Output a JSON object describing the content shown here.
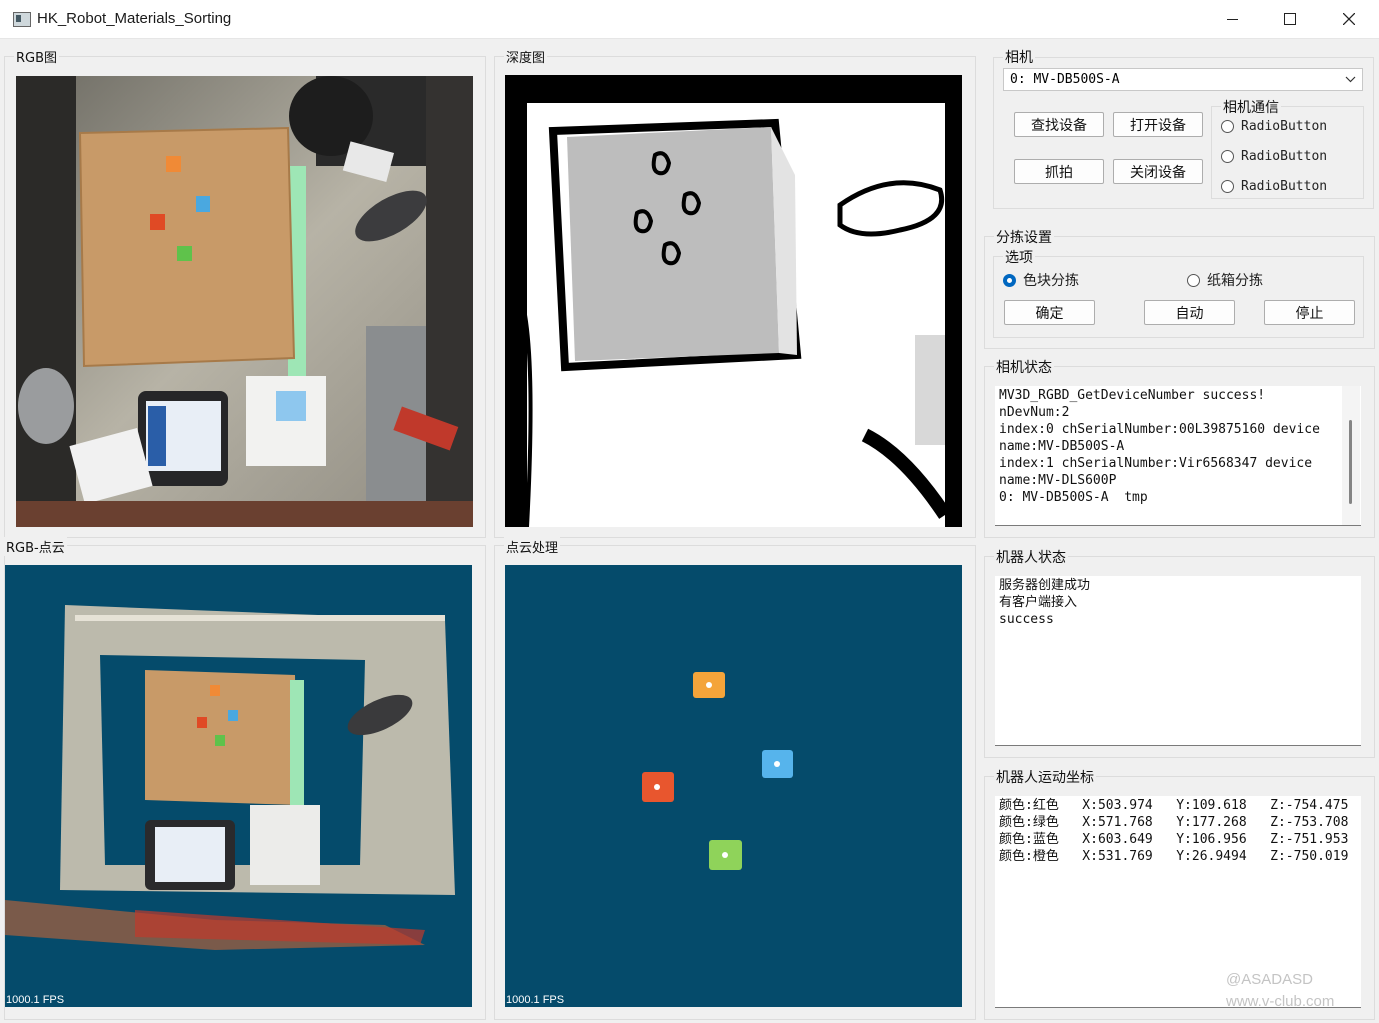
{
  "window": {
    "title": "HK_Robot_Materials_Sorting"
  },
  "panels": {
    "rgb": {
      "title": "RGB图"
    },
    "depth": {
      "title": "深度图"
    },
    "rgb_cloud": {
      "title": "RGB-点云",
      "fps": "1000.1 FPS"
    },
    "cloud_proc": {
      "title": "点云处理",
      "fps": "1000.1 FPS"
    }
  },
  "camera": {
    "title": "相机",
    "device_selected": "0: MV-DB500S-A",
    "buttons": {
      "find": "查找设备",
      "open": "打开设备",
      "capture": "抓拍",
      "close": "关闭设备"
    },
    "comm": {
      "title": "相机通信",
      "options": [
        "RadioButton",
        "RadioButton",
        "RadioButton"
      ]
    }
  },
  "sorting": {
    "title": "分拣设置",
    "options_title": "选项",
    "radio_color": "色块分拣",
    "radio_box": "纸箱分拣",
    "buttons": {
      "confirm": "确定",
      "auto": "自动",
      "stop": "停止"
    }
  },
  "camera_status": {
    "title": "相机状态",
    "text": "MV3D_RGBD_GetDeviceNumber success!\nnDevNum:2\nindex:0 chSerialNumber:00L39875160 device name:MV-DB500S-A\nindex:1 chSerialNumber:Vir6568347 device name:MV-DLS600P\n0: MV-DB500S-A  tmp"
  },
  "robot_status": {
    "title": "机器人状态",
    "text": "服务器创建成功\n有客户端接入\nsuccess"
  },
  "robot_coords": {
    "title": "机器人运动坐标",
    "text": "颜色:红色   X:503.974   Y:109.618   Z:-754.475\n颜色:绿色   X:571.768   Y:177.268   Z:-753.708\n颜色:蓝色   X:603.649   Y:106.956   Z:-751.953\n颜色:橙色   X:531.769   Y:26.9494   Z:-750.019"
  },
  "watermark": {
    "line1": "@ASADASD",
    "line2": "www.v-club.com"
  },
  "colors": {
    "cloud_bg": "#054b6b",
    "accent": "#0067c0",
    "orange": "#f4a43a",
    "red": "#e8562e",
    "blue": "#56b4ec",
    "green": "#8fd35a"
  }
}
